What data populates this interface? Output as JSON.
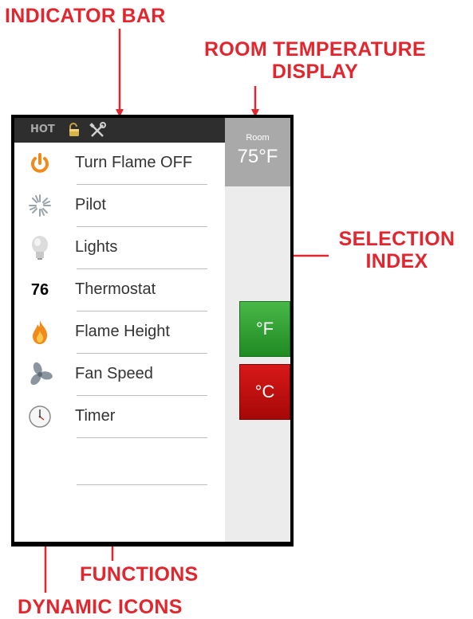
{
  "callouts": {
    "indicator_bar": "INDICATOR BAR",
    "room_temperature_line1": "ROOM TEMPERATURE",
    "room_temperature_line2": "DISPLAY",
    "selection_line1": "SELECTION",
    "selection_line2": "INDEX",
    "functions": "FUNCTIONS",
    "dynamic_icons": "DYNAMIC ICONS"
  },
  "indicator_bar": {
    "hot_label": "HOT",
    "icons": [
      "lock-open-icon",
      "tools-icon"
    ]
  },
  "room_display": {
    "label": "Room",
    "temperature": "75°F"
  },
  "unit_buttons": [
    {
      "label": "°F",
      "color": "#2ca02c"
    },
    {
      "label": "°C",
      "color": "#cc1111"
    }
  ],
  "menu": [
    {
      "icon": "power-icon",
      "label": "Turn Flame OFF"
    },
    {
      "icon": "pilot-icon",
      "label": "Pilot"
    },
    {
      "icon": "lightbulb-icon",
      "label": "Lights"
    },
    {
      "icon_text": "76",
      "label": "Thermostat"
    },
    {
      "icon": "flame-icon",
      "label": "Flame Height"
    },
    {
      "icon": "fan-icon",
      "label": "Fan Speed"
    },
    {
      "icon": "clock-icon",
      "label": "Timer"
    }
  ],
  "colors": {
    "callout": "#e3262d",
    "indicator_bar": "#2e2e2e",
    "room_box": "#a9a9a9",
    "selection_index": "#ececec",
    "power_icon": "#f08a1a"
  }
}
